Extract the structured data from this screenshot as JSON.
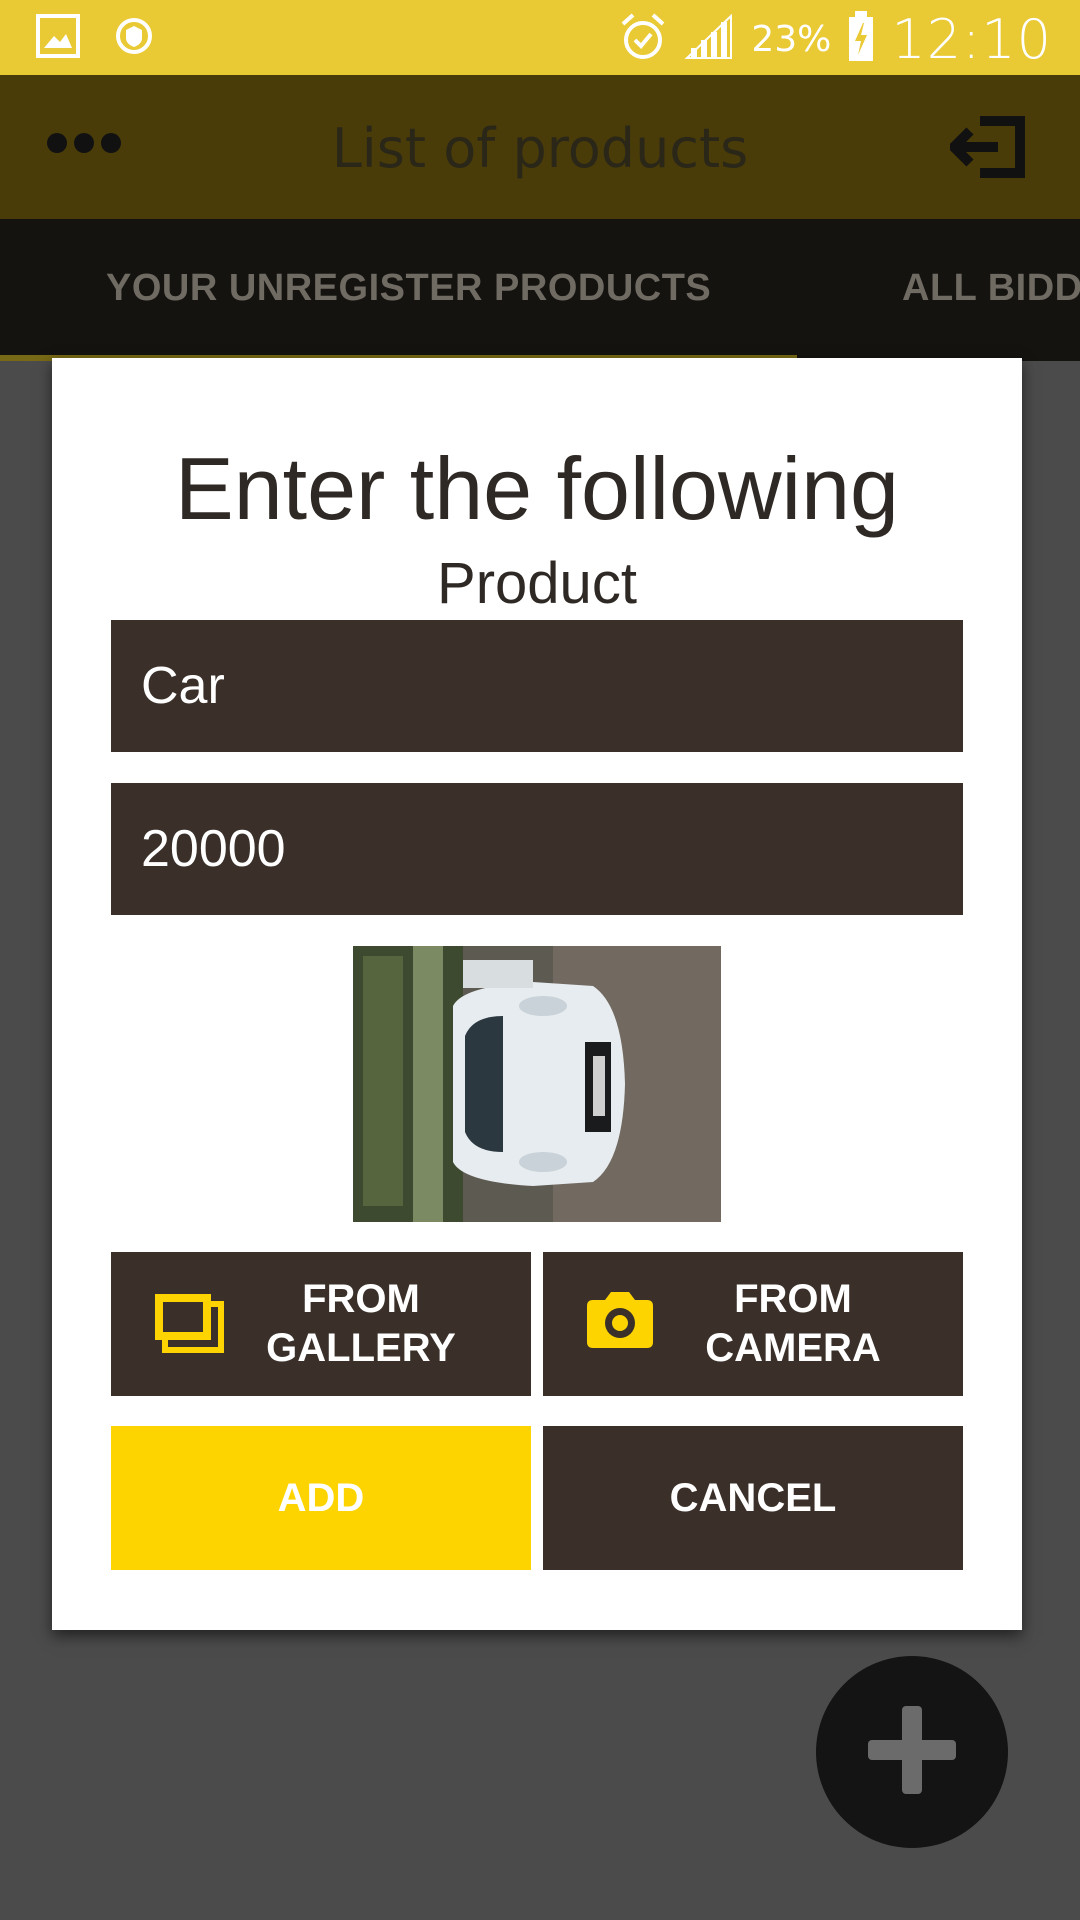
{
  "status_bar": {
    "battery_percent": "23%",
    "time": "12:10",
    "icons": [
      "gallery-notification-icon",
      "security-notification-icon",
      "alarm-icon",
      "signal-icon",
      "battery-charging-icon"
    ]
  },
  "app_bar": {
    "title": "List of products",
    "menu_icon": "more-dots-icon",
    "logout_icon": "logout-icon"
  },
  "tabs": [
    {
      "label": "YOUR UNREGISTER PRODUCTS",
      "selected": true
    },
    {
      "label": "ALL BIDD",
      "selected": false
    }
  ],
  "dialog": {
    "title": "Enter the following",
    "subtitle": "Product",
    "name_value": "Car",
    "price_value": "20000",
    "gallery_button": "FROM\nGALLERY",
    "camera_button": "FROM\nCAMERA",
    "add_button": "ADD",
    "cancel_button": "CANCEL"
  },
  "colors": {
    "status_bar": "#e9c934",
    "accent_yellow": "#fdd400",
    "dark_brown": "#3a3029"
  },
  "fab": {
    "icon": "plus-icon"
  }
}
